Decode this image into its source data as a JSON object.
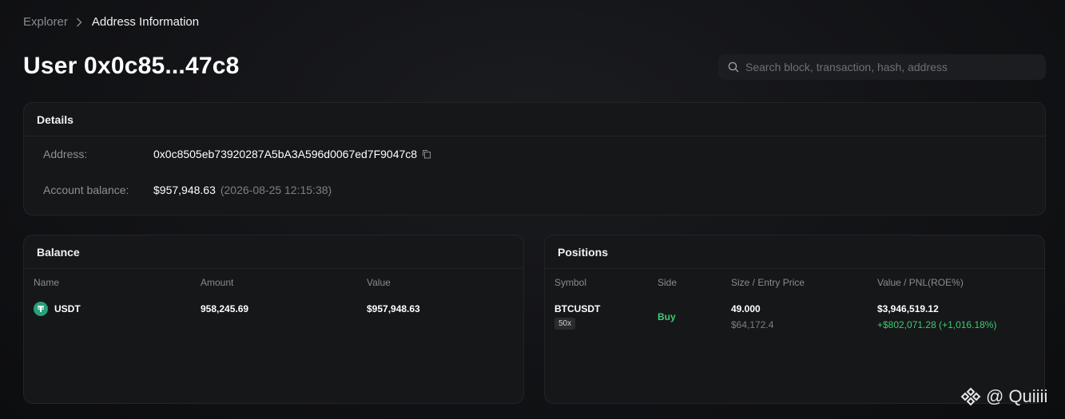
{
  "breadcrumb": {
    "root": "Explorer",
    "current": "Address Information"
  },
  "page": {
    "title": "User 0x0c85...47c8"
  },
  "search": {
    "placeholder": "Search block, transaction, hash, address"
  },
  "details": {
    "heading": "Details",
    "address_label": "Address:",
    "address_value": "0x0c8505eb73920287A5bA3A596d0067ed7F9047c8",
    "balance_label": "Account balance:",
    "balance_value": "$957,948.63",
    "balance_timestamp": "(2026-08-25 12:15:38)"
  },
  "balance": {
    "heading": "Balance",
    "columns": {
      "name": "Name",
      "amount": "Amount",
      "value": "Value"
    },
    "rows": [
      {
        "name": "USDT",
        "amount": "958,245.69",
        "value": "$957,948.63",
        "icon": "tether-icon"
      }
    ]
  },
  "positions": {
    "heading": "Positions",
    "columns": {
      "symbol": "Symbol",
      "side": "Side",
      "size": "Size / Entry Price",
      "value": "Value / PNL(ROE%)"
    },
    "rows": [
      {
        "symbol": "BTCUSDT",
        "leverage": "50x",
        "side": "Buy",
        "size": "49.000",
        "entry_price": "$64,172.4",
        "value": "$3,946,519.12",
        "pnl": "+$802,071.28 (+1,016.18%)"
      }
    ]
  },
  "watermark": {
    "text": "@ Quiiii"
  },
  "colors": {
    "accent_green": "#3ecb74",
    "tether": "#26a17b",
    "card_bg": "#161719"
  }
}
